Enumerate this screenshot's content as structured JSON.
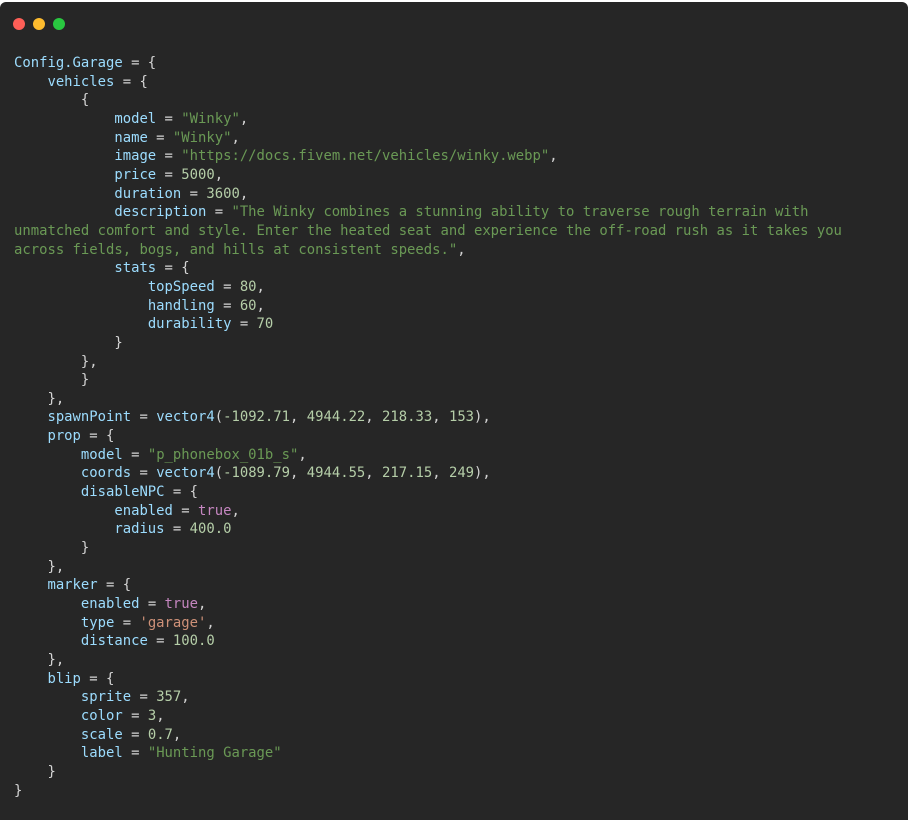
{
  "window": {
    "controls": [
      "close",
      "minimize",
      "maximize"
    ]
  },
  "code_lines": [
    [
      [
        "ident",
        "Config.Garage"
      ],
      [
        "punct",
        " = {"
      ]
    ],
    [
      [
        "punct",
        "    "
      ],
      [
        "key",
        "vehicles"
      ],
      [
        "punct",
        " = {"
      ]
    ],
    [
      [
        "punct",
        "        {"
      ]
    ],
    [
      [
        "punct",
        "            "
      ],
      [
        "key",
        "model"
      ],
      [
        "punct",
        " = "
      ],
      [
        "string",
        "\"Winky\""
      ],
      [
        "punct",
        ","
      ]
    ],
    [
      [
        "punct",
        "            "
      ],
      [
        "key",
        "name"
      ],
      [
        "punct",
        " = "
      ],
      [
        "string",
        "\"Winky\""
      ],
      [
        "punct",
        ","
      ]
    ],
    [
      [
        "punct",
        "            "
      ],
      [
        "key",
        "image"
      ],
      [
        "punct",
        " = "
      ],
      [
        "string",
        "\"https://docs.fivem.net/vehicles/winky.webp\""
      ],
      [
        "punct",
        ","
      ]
    ],
    [
      [
        "punct",
        "            "
      ],
      [
        "key",
        "price"
      ],
      [
        "punct",
        " = "
      ],
      [
        "number",
        "5000"
      ],
      [
        "punct",
        ","
      ]
    ],
    [
      [
        "punct",
        "            "
      ],
      [
        "key",
        "duration"
      ],
      [
        "punct",
        " = "
      ],
      [
        "number",
        "3600"
      ],
      [
        "punct",
        ","
      ]
    ],
    [
      [
        "punct",
        "            "
      ],
      [
        "key",
        "description"
      ],
      [
        "punct",
        " = "
      ],
      [
        "string",
        "\"The Winky combines a stunning ability to traverse rough terrain with"
      ]
    ],
    [
      [
        "string",
        "unmatched comfort and style. Enter the heated seat and experience the off-road rush as it takes you"
      ]
    ],
    [
      [
        "string",
        "across fields, bogs, and hills at consistent speeds.\""
      ],
      [
        "punct",
        ","
      ]
    ],
    [
      [
        "punct",
        "            "
      ],
      [
        "key",
        "stats"
      ],
      [
        "punct",
        " = {"
      ]
    ],
    [
      [
        "punct",
        "                "
      ],
      [
        "key",
        "topSpeed"
      ],
      [
        "punct",
        " = "
      ],
      [
        "number",
        "80"
      ],
      [
        "punct",
        ","
      ]
    ],
    [
      [
        "punct",
        "                "
      ],
      [
        "key",
        "handling"
      ],
      [
        "punct",
        " = "
      ],
      [
        "number",
        "60"
      ],
      [
        "punct",
        ","
      ]
    ],
    [
      [
        "punct",
        "                "
      ],
      [
        "key",
        "durability"
      ],
      [
        "punct",
        " = "
      ],
      [
        "number",
        "70"
      ]
    ],
    [
      [
        "punct",
        "            }"
      ]
    ],
    [
      [
        "punct",
        "        },"
      ]
    ],
    [
      [
        "punct",
        "        }"
      ]
    ],
    [
      [
        "punct",
        "    },"
      ]
    ],
    [
      [
        "punct",
        "    "
      ],
      [
        "key",
        "spawnPoint"
      ],
      [
        "punct",
        " = "
      ],
      [
        "func",
        "vector4"
      ],
      [
        "punct",
        "("
      ],
      [
        "number",
        "-1092.71"
      ],
      [
        "punct",
        ", "
      ],
      [
        "number",
        "4944.22"
      ],
      [
        "punct",
        ", "
      ],
      [
        "number",
        "218.33"
      ],
      [
        "punct",
        ", "
      ],
      [
        "number",
        "153"
      ],
      [
        "punct",
        "),"
      ]
    ],
    [
      [
        "punct",
        "    "
      ],
      [
        "key",
        "prop"
      ],
      [
        "punct",
        " = {"
      ]
    ],
    [
      [
        "punct",
        "        "
      ],
      [
        "key",
        "model"
      ],
      [
        "punct",
        " = "
      ],
      [
        "string",
        "\"p_phonebox_01b_s\""
      ],
      [
        "punct",
        ","
      ]
    ],
    [
      [
        "punct",
        "        "
      ],
      [
        "key",
        "coords"
      ],
      [
        "punct",
        " = "
      ],
      [
        "func",
        "vector4"
      ],
      [
        "punct",
        "("
      ],
      [
        "number",
        "-1089.79"
      ],
      [
        "punct",
        ", "
      ],
      [
        "number",
        "4944.55"
      ],
      [
        "punct",
        ", "
      ],
      [
        "number",
        "217.15"
      ],
      [
        "punct",
        ", "
      ],
      [
        "number",
        "249"
      ],
      [
        "punct",
        "),"
      ]
    ],
    [
      [
        "punct",
        "        "
      ],
      [
        "key",
        "disableNPC"
      ],
      [
        "punct",
        " = {"
      ]
    ],
    [
      [
        "punct",
        "            "
      ],
      [
        "key",
        "enabled"
      ],
      [
        "punct",
        " = "
      ],
      [
        "bool",
        "true"
      ],
      [
        "punct",
        ","
      ]
    ],
    [
      [
        "punct",
        "            "
      ],
      [
        "key",
        "radius"
      ],
      [
        "punct",
        " = "
      ],
      [
        "number",
        "400.0"
      ]
    ],
    [
      [
        "punct",
        "        }"
      ]
    ],
    [
      [
        "punct",
        "    },"
      ]
    ],
    [
      [
        "punct",
        "    "
      ],
      [
        "key",
        "marker"
      ],
      [
        "punct",
        " = {"
      ]
    ],
    [
      [
        "punct",
        "        "
      ],
      [
        "key",
        "enabled"
      ],
      [
        "punct",
        " = "
      ],
      [
        "bool",
        "true"
      ],
      [
        "punct",
        ","
      ]
    ],
    [
      [
        "punct",
        "        "
      ],
      [
        "key",
        "type"
      ],
      [
        "punct",
        " = "
      ],
      [
        "string-single",
        "'garage'"
      ],
      [
        "punct",
        ","
      ]
    ],
    [
      [
        "punct",
        "        "
      ],
      [
        "key",
        "distance"
      ],
      [
        "punct",
        " = "
      ],
      [
        "number",
        "100.0"
      ]
    ],
    [
      [
        "punct",
        "    },"
      ]
    ],
    [
      [
        "punct",
        "    "
      ],
      [
        "key",
        "blip"
      ],
      [
        "punct",
        " = {"
      ]
    ],
    [
      [
        "punct",
        "        "
      ],
      [
        "key",
        "sprite"
      ],
      [
        "punct",
        " = "
      ],
      [
        "number",
        "357"
      ],
      [
        "punct",
        ","
      ]
    ],
    [
      [
        "punct",
        "        "
      ],
      [
        "key",
        "color"
      ],
      [
        "punct",
        " = "
      ],
      [
        "number",
        "3"
      ],
      [
        "punct",
        ","
      ]
    ],
    [
      [
        "punct",
        "        "
      ],
      [
        "key",
        "scale"
      ],
      [
        "punct",
        " = "
      ],
      [
        "number",
        "0.7"
      ],
      [
        "punct",
        ","
      ]
    ],
    [
      [
        "punct",
        "        "
      ],
      [
        "key",
        "label"
      ],
      [
        "punct",
        " = "
      ],
      [
        "string",
        "\"Hunting Garage\""
      ]
    ],
    [
      [
        "punct",
        "    }"
      ]
    ],
    [
      [
        "punct",
        "}"
      ]
    ]
  ],
  "colors": {
    "background": "#262626",
    "close": "#fe5f57",
    "minimize": "#febc2e",
    "maximize": "#29c840",
    "identifier": "#9cdcfe",
    "string": "#6a9955",
    "number": "#b5cea8",
    "boolean": "#c586c0",
    "punctuation": "#d4d4d4"
  }
}
